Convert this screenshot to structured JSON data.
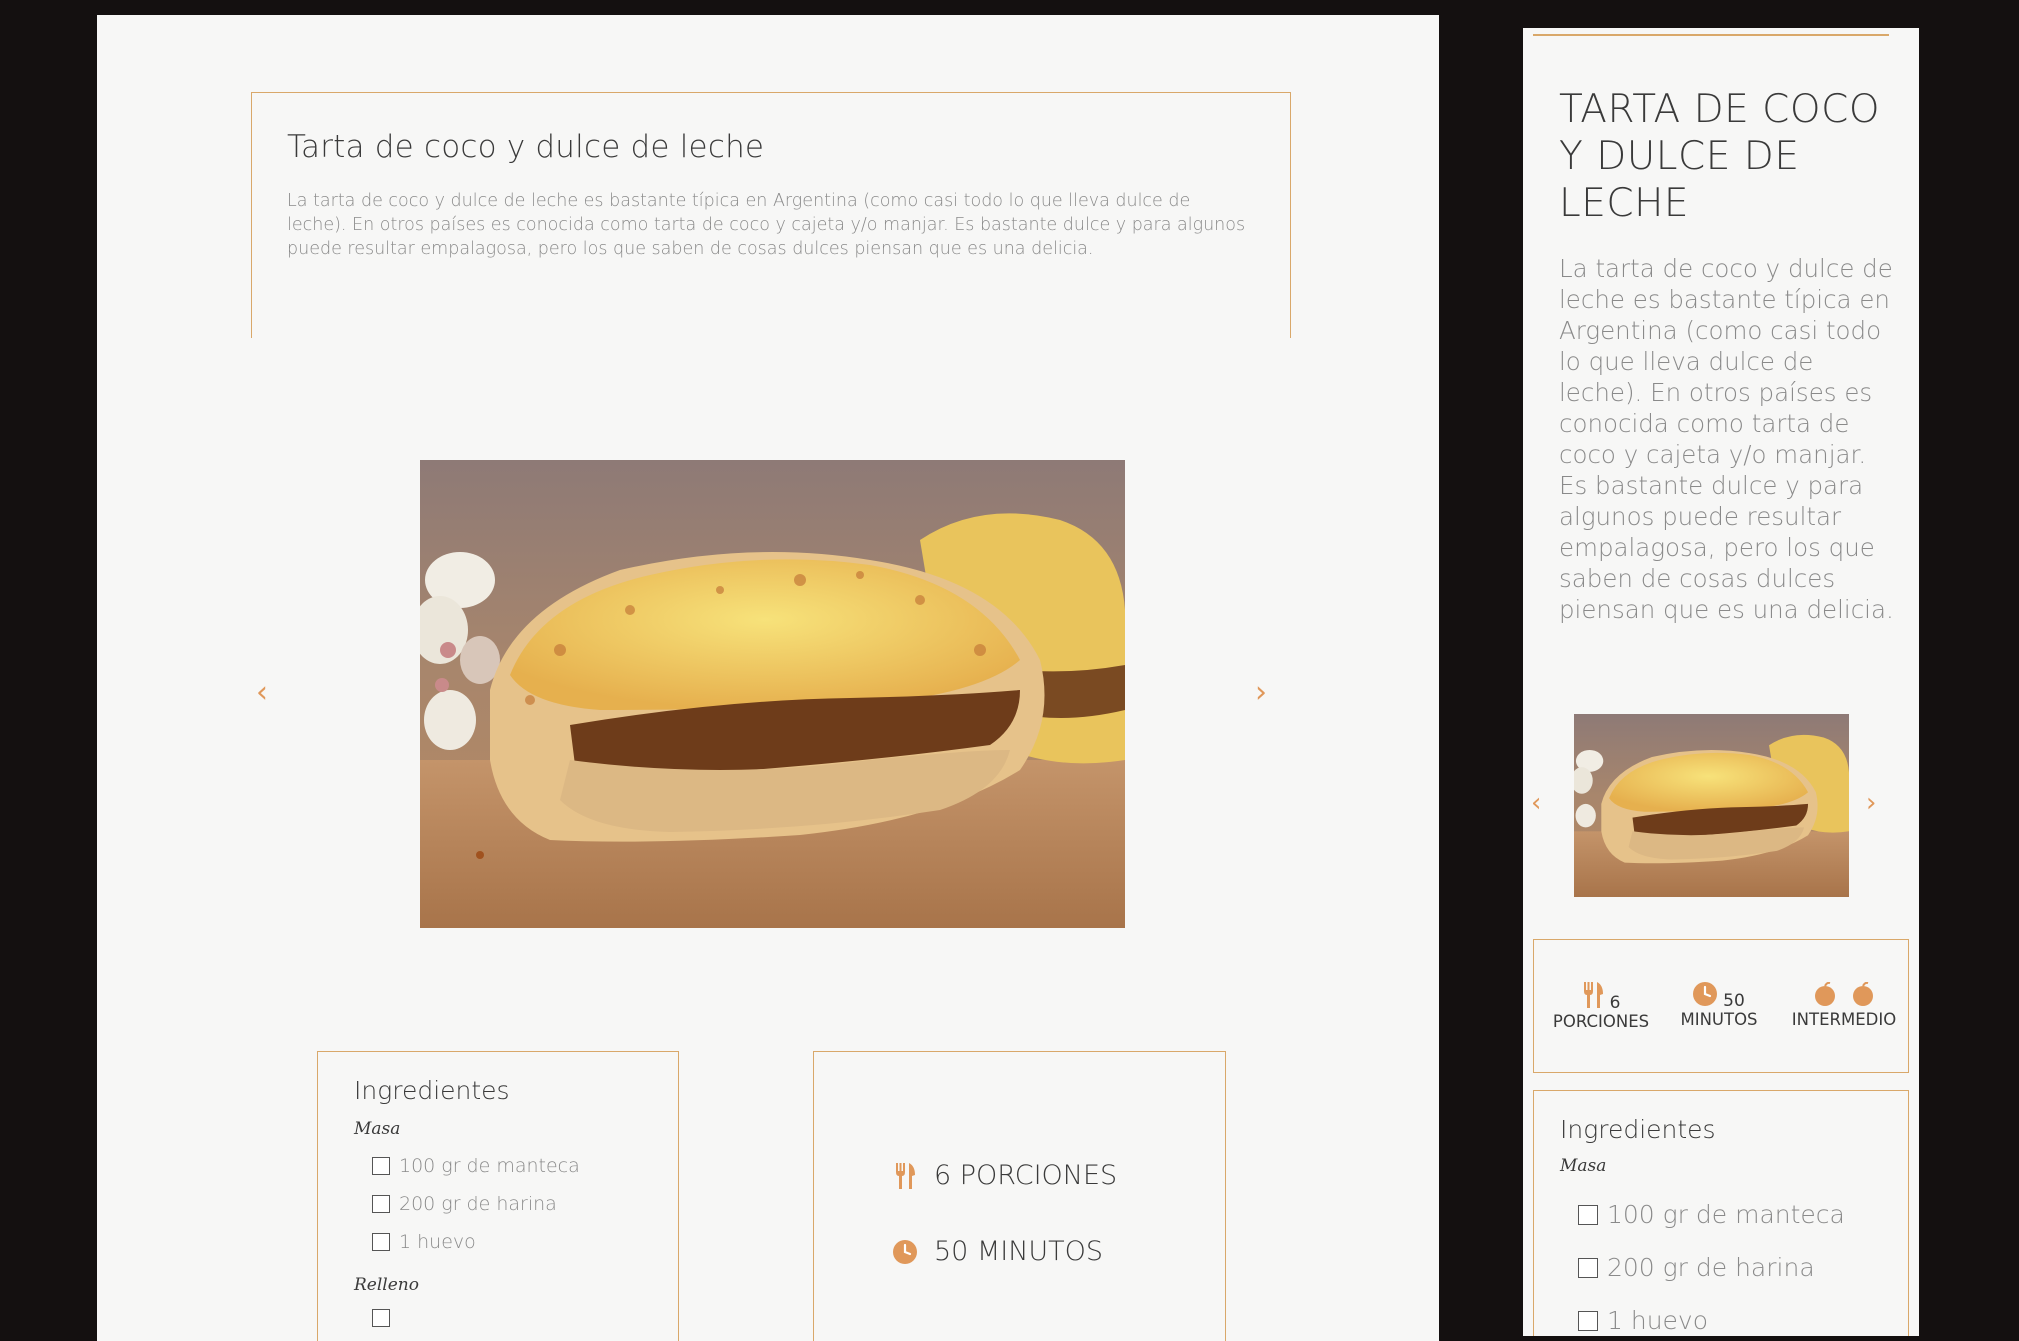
{
  "recipe": {
    "title": "Tarta de coco y dulce de leche",
    "title_upper": "TARTA DE COCO Y DULCE DE LECHE",
    "description": "La tarta de coco y dulce de leche es bastante típica en Argentina (como casi todo lo que lleva dulce de leche). En otros países es conocida como tarta de coco y cajeta y/o manjar. Es bastante dulce y para algunos puede resultar empalagosa, pero los que saben de cosas dulces piensan que es una delicia."
  },
  "carousel": {
    "prev_icon": "chevron-left-icon",
    "next_icon": "chevron-right-icon",
    "prev_glyph": "‹",
    "next_glyph": "›"
  },
  "ingredients": {
    "title": "Ingredientes",
    "groups": [
      {
        "label": "Masa",
        "items": [
          "100 gr de manteca",
          "200 gr de harina",
          "1 huevo"
        ]
      },
      {
        "label": "Relleno",
        "items": []
      }
    ]
  },
  "info": {
    "portions": "6 PORCIONES",
    "minutes": "50 MINUTOS"
  },
  "stats": {
    "portions_num": "6",
    "portions_label": "PORCIONES",
    "minutes_num": "50",
    "minutes_label": "MINUTOS",
    "difficulty_label": "INTERMEDIO"
  },
  "colors": {
    "accent": "#e0985a",
    "border": "#d9a86a",
    "background": "#f7f7f6",
    "frame": "#141010"
  }
}
